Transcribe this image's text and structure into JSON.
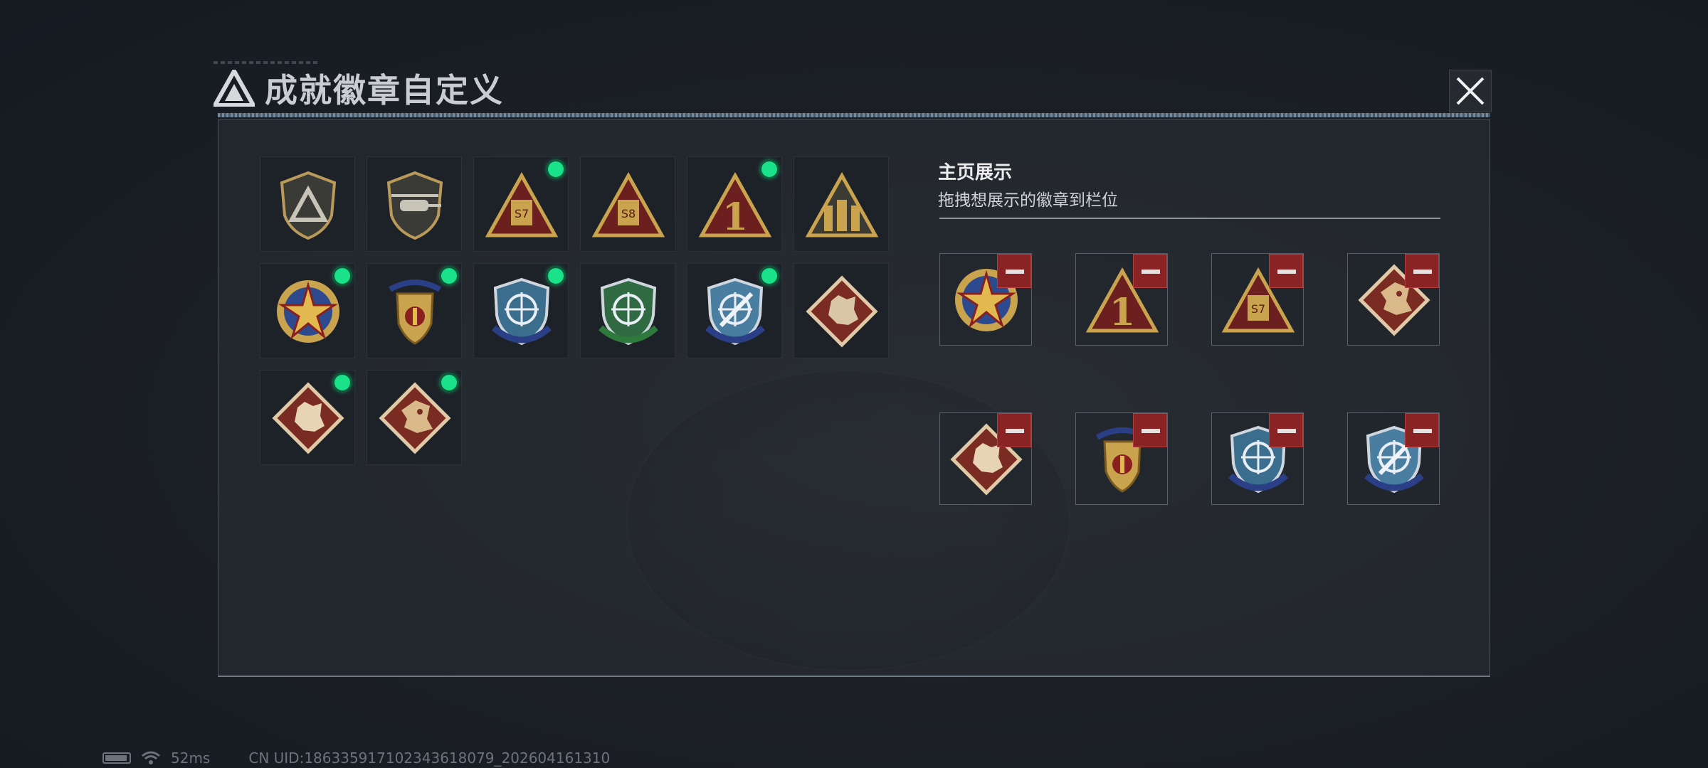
{
  "dialog": {
    "title": "成就徽章自定义",
    "close_icon": "close-icon"
  },
  "badge_grid": {
    "items": [
      {
        "name": "tri-shield-badge",
        "new": false
      },
      {
        "name": "helicopter-shield-badge",
        "new": false
      },
      {
        "name": "s7-tri-badge",
        "new": true
      },
      {
        "name": "s8-tri-badge",
        "new": false
      },
      {
        "name": "rank-one-tri-badge",
        "new": true
      },
      {
        "name": "soldiers-tri-badge",
        "new": false
      },
      {
        "name": "star-medal-badge",
        "new": true
      },
      {
        "name": "winged-crest-badge",
        "new": true
      },
      {
        "name": "blue-rifle-shield-badge",
        "new": true
      },
      {
        "name": "green-rifle-shield-badge",
        "new": false
      },
      {
        "name": "blue-knife-shield-badge",
        "new": true
      },
      {
        "name": "wolf-diamond-badge-dark",
        "new": false
      },
      {
        "name": "wolf-diamond-badge",
        "new": true
      },
      {
        "name": "dragon-diamond-badge",
        "new": true
      }
    ]
  },
  "showcase": {
    "title": "主页展示",
    "subtitle": "拖拽想展示的徽章到栏位",
    "slots": [
      {
        "name": "star-medal-badge"
      },
      {
        "name": "rank-one-tri-badge"
      },
      {
        "name": "s7-tri-badge"
      },
      {
        "name": "dragon-diamond-badge"
      },
      {
        "name": "wolf-diamond-badge"
      },
      {
        "name": "winged-crest-badge"
      },
      {
        "name": "blue-rifle-shield-badge"
      },
      {
        "name": "blue-knife-shield-badge"
      }
    ]
  },
  "status_bar": {
    "ping": "52ms",
    "uid": "CN UID:18633591710234361807​9_202604161310"
  },
  "colors": {
    "accent_green": "#19e28a",
    "remove_red": "#8a2424",
    "gold": "#c9a34e"
  }
}
